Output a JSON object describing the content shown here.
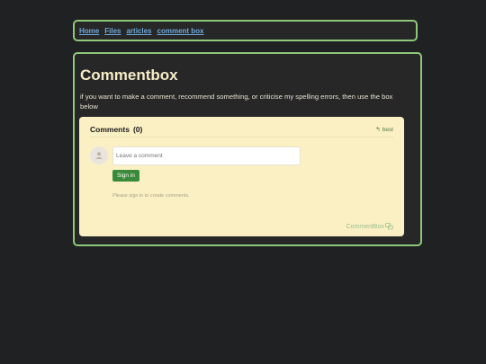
{
  "nav": {
    "links": [
      "Home",
      "Files",
      "articles",
      "comment box"
    ]
  },
  "main": {
    "title": "Commentbox",
    "intro": "if you want to make a comment, recommend something, or criticise my spelling errors, then use the box below"
  },
  "commentbox": {
    "heading": "Comments",
    "count": "(0)",
    "sort_label": "best",
    "input_placeholder": "Leave a comment",
    "signin_label": "Sign in",
    "signin_note": "Please sign in to create comments.",
    "brand": "CommentBox"
  },
  "colors": {
    "background": "#202122",
    "panel": "#272728",
    "panel_border": "#8fc77b",
    "link": "#6ea7d8",
    "title": "#f6edc8",
    "comment_bg": "#fbf0c4",
    "signin_button": "#3a8a3c"
  }
}
